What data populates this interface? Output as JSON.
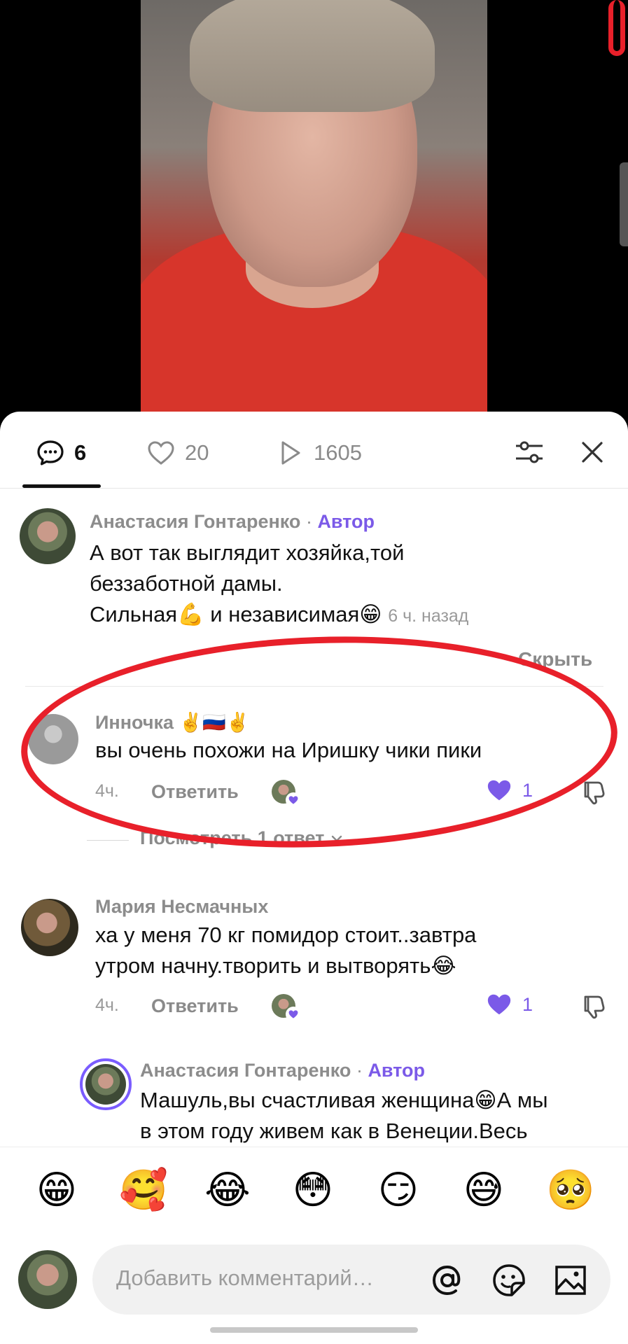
{
  "tabs": {
    "comments_count": "6",
    "likes_count": "20",
    "views_count": "1605"
  },
  "comments": [
    {
      "author": "Анастасия Гонтаренко",
      "badge": "Автор",
      "text_line1": "А вот так выглядит хозяйка,той",
      "text_line2": "беззаботной дамы.",
      "text_line3": "Сильная💪 и независимая😁",
      "time": "6 ч. назад",
      "hide_label": "Скрыть"
    },
    {
      "author": "Инночка ✌️🇷🇺✌️",
      "text": "вы очень похожи на Иришку чики пики",
      "time": "4ч.",
      "reply_label": "Ответить",
      "likes": "1",
      "view_replies": "Посмотреть 1 ответ"
    },
    {
      "author": "Мария Несмачных",
      "text_line1": "ха у меня 70 кг помидор стоит..завтра",
      "text_line2": "утром начну.творить и вытворять😂",
      "time": "4ч.",
      "reply_label": "Ответить",
      "likes": "1"
    },
    {
      "author": "Анастасия Гонтаренко",
      "badge": "Автор",
      "text_line1": "Машуль,вы счастливая женщина😁А мы",
      "text_line2": "в этом году живем как в Венеции.Весь"
    }
  ],
  "emoji_bar": [
    "😁",
    "🥰",
    "😂",
    "😳",
    "😏",
    "😅",
    "🥺"
  ],
  "composer": {
    "placeholder": "Добавить комментарий…"
  },
  "colors": {
    "accent": "#7b5ae8",
    "annotation": "#e8202a"
  }
}
